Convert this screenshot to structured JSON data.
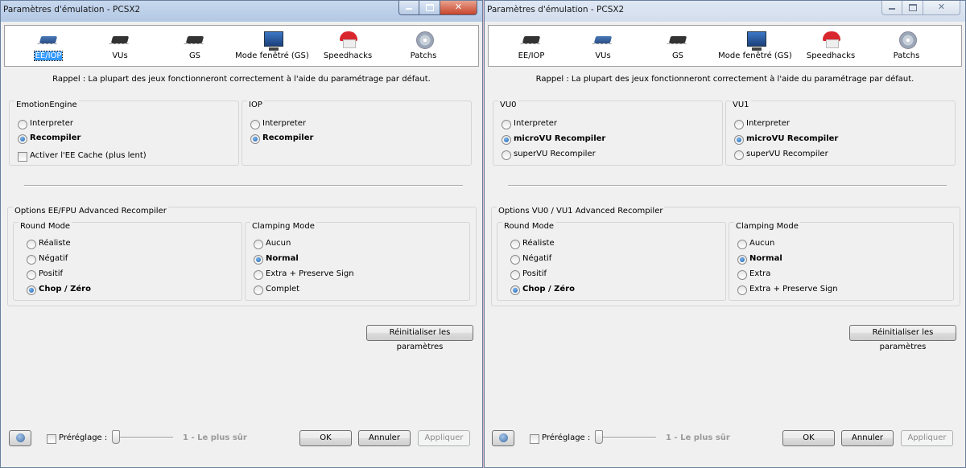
{
  "left": {
    "title": "Paramètres d'émulation - PCSX2",
    "tabs": [
      "EE/IOP",
      "VUs",
      "GS",
      "Mode fenêtré (GS)",
      "Speedhacks",
      "Patchs"
    ],
    "selected_tab": "EE/IOP",
    "rappel": "Rappel : La plupart des jeux fonctionneront correctement à l'aide du paramétrage par défaut.",
    "box1": {
      "title": "EmotionEngine",
      "options": [
        "Interpreter",
        "Recompiler"
      ],
      "selected": "Recompiler",
      "checkbox": "Activer l'EE Cache (plus lent)",
      "checked": false
    },
    "box2": {
      "title": "IOP",
      "options": [
        "Interpreter",
        "Recompiler"
      ],
      "selected": "Recompiler"
    },
    "advanced_title": "Options EE/FPU Advanced Recompiler",
    "round": {
      "title": "Round Mode",
      "options": [
        "Réaliste",
        "Négatif",
        "Positif",
        "Chop / Zéro"
      ],
      "selected": "Chop / Zéro"
    },
    "clamp": {
      "title": "Clamping Mode",
      "options": [
        "Aucun",
        "Normal",
        "Extra + Preserve Sign",
        "Complet"
      ],
      "selected": "Normal"
    }
  },
  "right": {
    "title": "Paramètres d'émulation - PCSX2",
    "tabs": [
      "EE/IOP",
      "VUs",
      "GS",
      "Mode fenêtré (GS)",
      "Speedhacks",
      "Patchs"
    ],
    "selected_tab": "VUs",
    "rappel": "Rappel : La plupart des jeux fonctionneront correctement à l'aide du paramétrage par défaut.",
    "box1": {
      "title": "VU0",
      "options": [
        "Interpreter",
        "microVU Recompiler",
        "superVU Recompiler"
      ],
      "selected": "microVU Recompiler"
    },
    "box2": {
      "title": "VU1",
      "options": [
        "Interpreter",
        "microVU Recompiler",
        "superVU Recompiler"
      ],
      "selected": "microVU Recompiler"
    },
    "advanced_title": "Options VU0 / VU1 Advanced Recompiler",
    "round": {
      "title": "Round Mode",
      "options": [
        "Réaliste",
        "Négatif",
        "Positif",
        "Chop / Zéro"
      ],
      "selected": "Chop / Zéro"
    },
    "clamp": {
      "title": "Clamping Mode",
      "options": [
        "Aucun",
        "Normal",
        "Extra",
        "Extra + Preserve Sign"
      ],
      "selected": "Normal"
    }
  },
  "common": {
    "reset_button": "Réinitialiser les paramètres",
    "preset_label": "Préréglage :",
    "preset_value": "1 - Le plus sûr",
    "ok_button": "OK",
    "cancel_button": "Annuler",
    "apply_button": "Appliquer"
  },
  "icons": {
    "tabs": [
      "cpu-chip-icon",
      "vu-chip-icon",
      "gs-chip-icon",
      "monitor-icon",
      "mushroom-icon",
      "disc-icon"
    ],
    "help": "help-globe-icon"
  }
}
